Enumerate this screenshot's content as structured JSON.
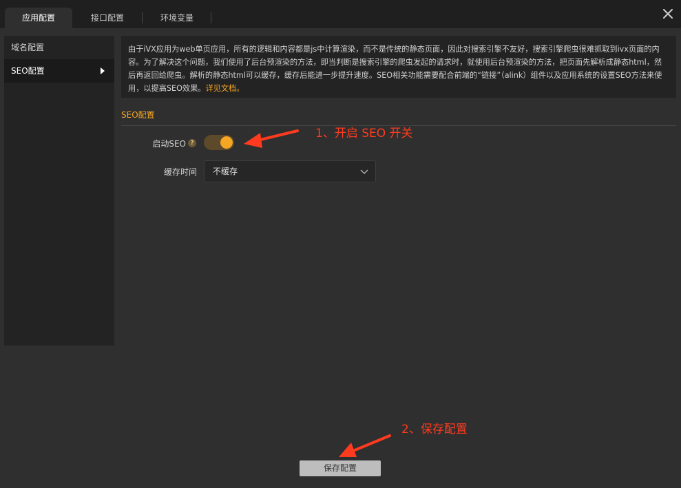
{
  "tabs": [
    {
      "label": "应用配置",
      "active": true
    },
    {
      "label": "接口配置",
      "active": false
    },
    {
      "label": "环境变量",
      "active": false
    }
  ],
  "sidebar": {
    "items": [
      {
        "label": "域名配置",
        "active": false
      },
      {
        "label": "SEO配置",
        "active": true
      }
    ]
  },
  "notice": {
    "text": "由于iVX应用为web单页应用，所有的逻辑和内容都是js中计算渲染，而不是传统的静态页面，因此对搜索引擎不友好，搜索引擎爬虫很难抓取到ivx页面的内容。为了解决这个问题，我们使用了后台预渲染的方法，即当判断是搜索引擎的爬虫发起的请求时，就使用后台预渲染的方法，把页面先解析成静态html，然后再返回给爬虫。解析的静态html可以缓存，缓存后能进一步提升速度。SEO相关功能需要配合前端的“链接”（alink）组件以及应用系统的设置SEO方法来使用，以提高SEO效果。",
    "link": "详见文档。"
  },
  "section": {
    "title": "SEO配置"
  },
  "form": {
    "enable_seo_label": "启动SEO",
    "help_symbol": "?",
    "enable_seo_on": true,
    "cache_time_label": "缓存时间",
    "cache_time_value": "不缓存"
  },
  "annotations": {
    "step1": "1、开启 SEO 开关",
    "step2": "2、保存配置"
  },
  "footer": {
    "save_label": "保存配置"
  },
  "colors": {
    "accent": "#f5a623",
    "annotation": "#ff3b1f"
  }
}
